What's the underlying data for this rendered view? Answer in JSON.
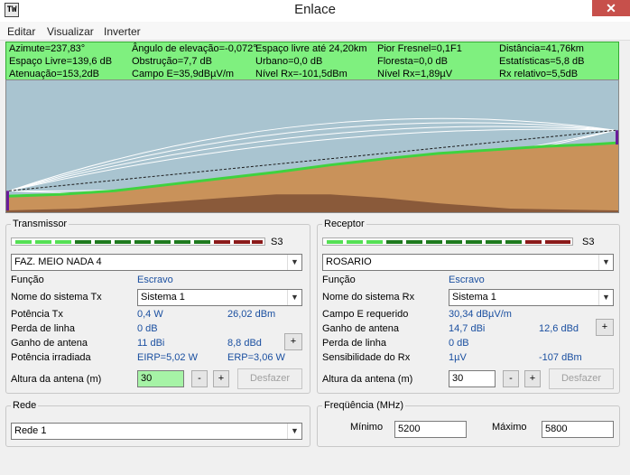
{
  "window": {
    "title": "Enlace",
    "icon_text": "TW",
    "close_label": "✕"
  },
  "menu": [
    "Editar",
    "Visualizar",
    "Inverter"
  ],
  "status": {
    "azimute": "Azimute=237,83°",
    "angulo": "Ângulo de elevação=-0,072°",
    "espaco_livre_ate": "Espaço livre até 24,20km",
    "pior_fresnel": "Pior Fresnel=0,1F1",
    "distancia": "Distância=41,76km",
    "espaco_livre": "Espaço Livre=139,6 dB",
    "obstrucao": "Obstrução=7,7 dB",
    "urbano": "Urbano=0,0 dB",
    "floresta": "Floresta=0,0 dB",
    "estatisticas": "Estatísticas=5,8 dB",
    "atenuacao": "Atenuação=153,2dB",
    "campo_e": "Campo E=35,9dBµV/m",
    "nivel_rx_dbm": "Nível Rx=-101,5dBm",
    "nivel_rx_uv": "Nível Rx=1,89µV",
    "rx_relativo": "Rx relativo=5,5dB"
  },
  "transmissor": {
    "title": "Transmissor",
    "meter_label": "S3",
    "station": "FAZ. MEIO NADA 4",
    "funcao_label": "Função",
    "funcao_value": "Escravo",
    "sistema_label": "Nome do sistema Tx",
    "sistema_value": "Sistema  1",
    "potencia_label": "Potência Tx",
    "potencia_w": "0,4 W",
    "potencia_dbm": "26,02 dBm",
    "perda_label": "Perda de linha",
    "perda_value": "0 dB",
    "ganho_label": "Ganho de antena",
    "ganho_dbi": "11 dBi",
    "ganho_dbd": "8,8 dBd",
    "irradiada_label": "Potência irradiada",
    "eirp": "EIRP=5,02 W",
    "erp": "ERP=3,06 W",
    "altura_label": "Altura da antena (m)",
    "altura_value": "30",
    "plus": "+",
    "minus": "-",
    "desfazer": "Desfazer"
  },
  "receptor": {
    "title": "Receptor",
    "meter_label": "S3",
    "station": "ROSARIO",
    "funcao_label": "Função",
    "funcao_value": "Escravo",
    "sistema_label": "Nome do sistema Rx",
    "sistema_value": "Sistema  1",
    "campo_label": "Campo E requerido",
    "campo_value": "30,34 dBµV/m",
    "ganho_label": "Ganho de antena",
    "ganho_dbi": "14,7 dBi",
    "ganho_dbd": "12,6 dBd",
    "perda_label": "Perda de linha",
    "perda_value": "0 dB",
    "sens_label": "Sensibilidade do Rx",
    "sens_uv": "1µV",
    "sens_dbm": "-107 dBm",
    "altura_label": "Altura da antena (m)",
    "altura_value": "30",
    "plus": "+",
    "minus": "-",
    "desfazer": "Desfazer"
  },
  "rede": {
    "title": "Rede",
    "value": "Rede  1"
  },
  "frequencia": {
    "title": "Freqüência (MHz)",
    "min_label": "Mínimo",
    "min_value": "5200",
    "max_label": "Máximo",
    "max_value": "5800"
  },
  "colors": {
    "sky": "#a9c4d0",
    "terrain_light": "#c9925a",
    "terrain_dark": "#8a5a3a",
    "ground_line": "#3fd23f",
    "status_bg": "#7ff07f",
    "accent_value": "#1a4fa0"
  },
  "meter": {
    "segments": [
      "#55e055",
      "#55e055",
      "#55e055",
      "#1e7a1e",
      "#1e7a1e",
      "#1e7a1e",
      "#1e7a1e",
      "#1e7a1e",
      "#1e7a1e",
      "#1e7a1e",
      "#8b1a1a",
      "#8b1a1a",
      "#8b1a1a"
    ]
  }
}
